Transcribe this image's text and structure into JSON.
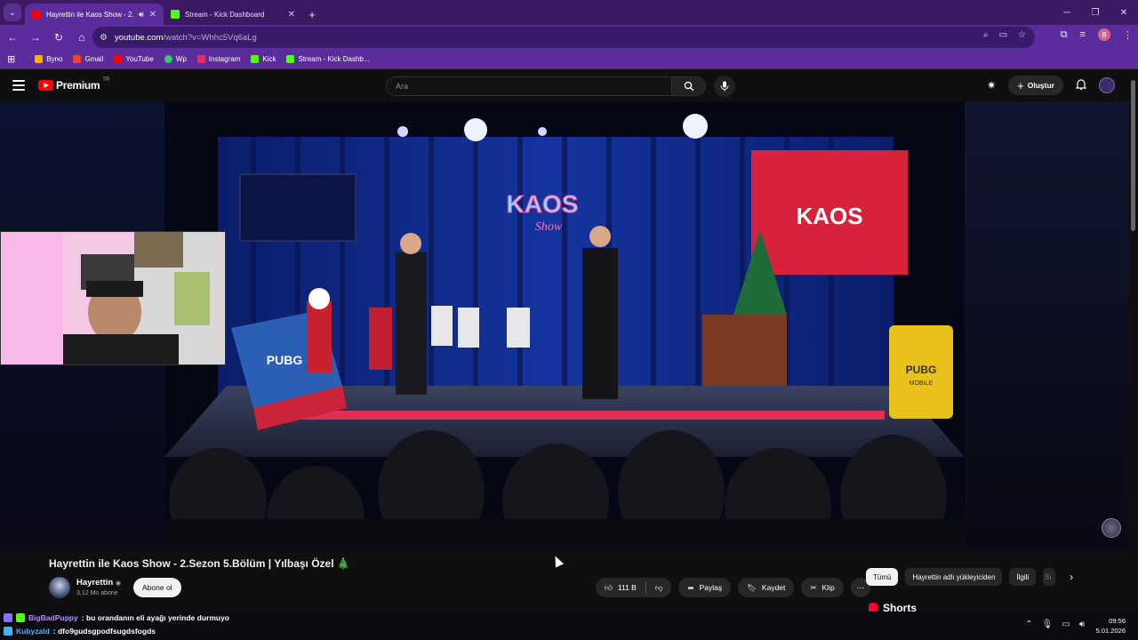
{
  "browser": {
    "tabs": [
      {
        "title": "Hayrettin ile Kaos Show - 2.",
        "active": true,
        "favicon_color": "#ff0000"
      },
      {
        "title": "Stream - Kick Dashboard",
        "active": false,
        "favicon_color": "#53fc18"
      }
    ],
    "url_host": "youtube.com",
    "url_rest": "/watch?v=Whhc5Vq6aLg",
    "profile_initial": "B",
    "bookmarks": [
      {
        "label": "Byno",
        "color": "#ffb400"
      },
      {
        "label": "Gmail",
        "color": "#ea4335"
      },
      {
        "label": "YouTube",
        "color": "#ff0000"
      },
      {
        "label": "Wp",
        "color": "#25d366"
      },
      {
        "label": "Instagram",
        "color": "#e1306c"
      },
      {
        "label": "Kick",
        "color": "#53fc18"
      },
      {
        "label": "Stream - Kick Dashb...",
        "color": "#53fc18"
      }
    ]
  },
  "youtube": {
    "brand": "Premium",
    "region": "TR",
    "search_placeholder": "Ara",
    "create_label": "Oluştur",
    "video": {
      "title": "Hayrettin ile Kaos Show - 2.Sezon 5.Bölüm | Yılbaşı Özel 🎄",
      "channel": "Hayrettin",
      "verified_mark": "◉",
      "subscribers": "3,12 Mn abone",
      "subscribe_label": "Abone ol",
      "likes": "111 B",
      "share_label": "Paylaş",
      "save_label": "Kaydet",
      "clip_label": "Klip",
      "show_sign": "KAOS",
      "show_sign_sub": "Show",
      "board_sign": "KAOS",
      "pubg_text": "PUBG",
      "pubg_sub": "MOBILE"
    },
    "chips": [
      {
        "label": "Tümü",
        "active": true
      },
      {
        "label": "Hayrettin adlı yükleyiciden",
        "active": false
      },
      {
        "label": "İlgili",
        "active": false
      },
      {
        "label": "Sı",
        "active": false
      }
    ],
    "shorts_label": "Shorts"
  },
  "chat": [
    {
      "user": "BigBadPuppy",
      "user_color": "#b98bff",
      "text": ": bu orandanın eli ayağı yerinde durmuyo"
    },
    {
      "user": "Kubyzald",
      "user_color": "#3fb4ff",
      "text": ": dfo9gudsgpodfsugdsfogds"
    }
  ],
  "taskbar": {
    "time": "09:56",
    "date": "5.01.2026"
  }
}
